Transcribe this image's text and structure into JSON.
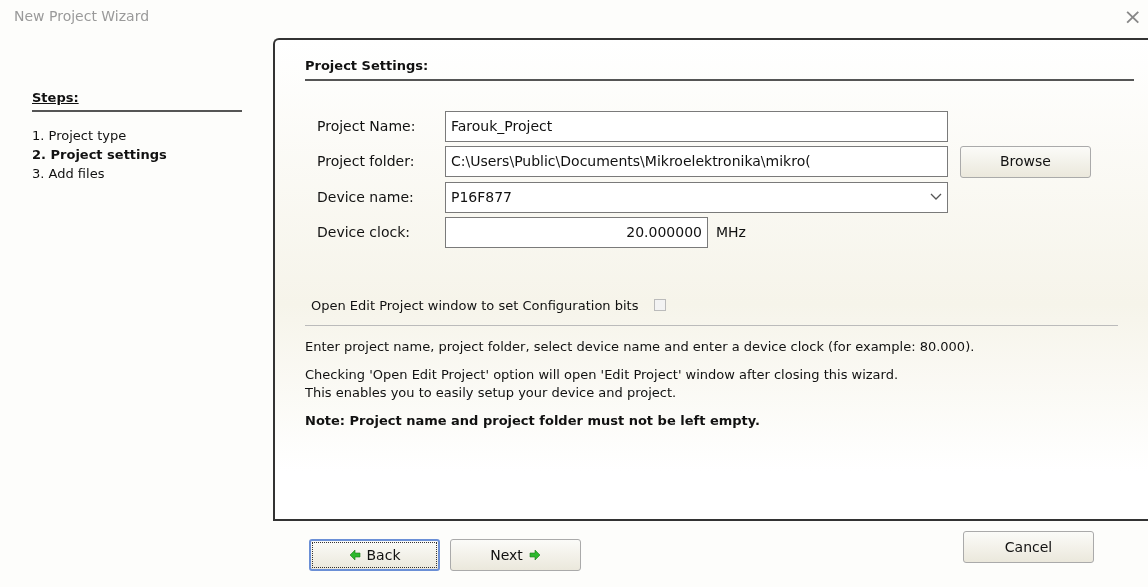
{
  "window": {
    "title": "New Project Wizard",
    "close": "×"
  },
  "steps": {
    "heading": "Steps:",
    "items": [
      {
        "label": "1. Project type",
        "selected": false
      },
      {
        "label": "2. Project settings",
        "selected": true
      },
      {
        "label": "3. Add files",
        "selected": false
      }
    ]
  },
  "panel": {
    "heading": "Project Settings:",
    "fields": [
      {
        "kind": "text",
        "label": "Project Name:",
        "value": "Farouk_Project"
      },
      {
        "kind": "text",
        "label": "Project folder:",
        "value": "C:\\Users\\Public\\Documents\\Mikroelektronika\\mikro(",
        "button": {
          "label": "Browse"
        }
      },
      {
        "kind": "select",
        "label": "Device name:",
        "value": "P16F877"
      },
      {
        "kind": "number",
        "label": "Device clock:",
        "value": "20.000000",
        "unit": "MHz"
      }
    ],
    "option": {
      "label": "Open Edit Project window to set Configuration bits",
      "checked": false
    },
    "notes": [
      {
        "text": "Enter project name, project folder, select device name and enter a device clock (for example: 80.000).",
        "bold": false
      },
      {
        "text": "Checking 'Open Edit Project' option will open 'Edit Project' window after closing this wizard.\nThis enables you to easily setup your device and project.",
        "bold": false
      },
      {
        "text": "Note: Project name and project folder must not be left empty.",
        "bold": true
      }
    ]
  },
  "buttons": [
    {
      "label": "Back",
      "kind": "back",
      "focused": true
    },
    {
      "label": "Next",
      "kind": "next",
      "focused": false
    },
    {
      "label": "Cancel",
      "kind": "plain",
      "focused": false
    }
  ]
}
